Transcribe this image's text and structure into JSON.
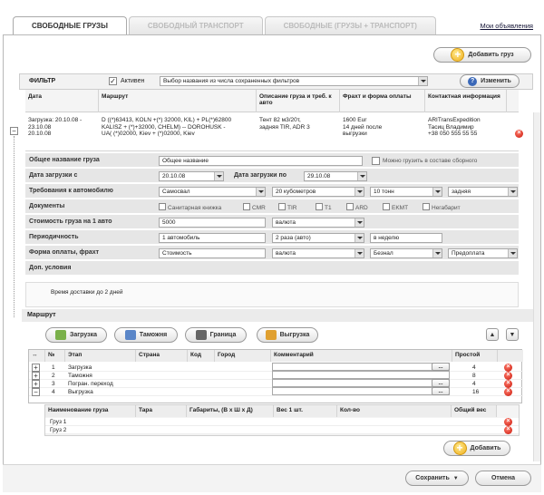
{
  "tabs": [
    {
      "label": "СВОБОДНЫЕ ГРУЗЫ"
    },
    {
      "label": "СВОБОДНЫЙ ТРАНСПОРТ"
    },
    {
      "label": "СВОБОДНЫЕ (ГРУЗЫ + ТРАНСПОРТ)"
    }
  ],
  "top_link": "Мои объявления",
  "add_cargo_label": "Добавить груз",
  "filter": {
    "label": "ФИЛЬТР",
    "active_label": "Активен",
    "active_checked": "✓",
    "saved_select": "Выбор названия из числа сохраненных фильтров",
    "change_label": "Изменить"
  },
  "columns": {
    "date": "Дата",
    "route": "Маршрут",
    "desc": "Описание груза и треб. к авто",
    "freight": "Фрахт и форма оплаты",
    "contact": "Контактная информация"
  },
  "summary": {
    "date": "Загрузка: 20.10.08 -\n        23.10.08\n20.10.08",
    "route": "D ((*)63413, KOLN  +(*) 32000, KIL) + PL(*)62800\nKALISZ + (*)+32000, CHELM) -- DOROHUSK -\nUA( (*)02000, Kiev + (*)02000, Kiev",
    "desc": "Тент 82 м3/20т,\nзадняя TIR, ADR 3",
    "freight": "1600 Eur\n14 дней после\nвыгрузки",
    "contact": "ARITransExpedition\nТасиц Владимир\n+38 050 555 55 55"
  },
  "form": {
    "cargo_name_label": "Общее название груза",
    "cargo_name_value": "Общее название",
    "consolidated_label": "Можно грузить в составе сборного",
    "load_from_label": "Дата загрузки с",
    "load_from_value": "20.10.08",
    "load_to_label": "Дата загрузки по",
    "load_to_value": "29.10.08",
    "req_label": "Требования к автомобилю",
    "req_body": "Самосвал",
    "req_volume": "20 кубометров",
    "req_weight": "10 тонн",
    "req_loading": "задняя",
    "docs_label": "Документы",
    "docs": [
      "Санитарная книжка",
      "CMR",
      "TIR",
      "T1",
      "ARD",
      "EKMT",
      "Негабарит"
    ],
    "cost_label": "Стоимость груза на 1 авто",
    "cost_value": "5000",
    "cost_currency": "валюта",
    "period_label": "Периодичность",
    "period_autos": "1 автомобиль",
    "period_times": "2 раза (авто)",
    "period_unit": "в неделю",
    "pay_label": "Форма оплаты, фрахт",
    "pay_cost": "Стоимость",
    "pay_currency": "валюта",
    "pay_type": "Безнал",
    "pay_terms": "Предоплата",
    "extra_label": "Доп. условия",
    "extra_value": "Время доставки до 2 дней"
  },
  "route": {
    "title": "Маршрут",
    "buttons": [
      "Загрузка",
      "Таможня",
      "Граница",
      "Выгрузка"
    ],
    "headers": [
      "№",
      "Этап",
      "Страна",
      "Код",
      "Город",
      "Комментарий",
      "Простой"
    ],
    "rows": [
      {
        "n": "1",
        "stage": "Загрузка",
        "idle": "4",
        "toggle": "+"
      },
      {
        "n": "2",
        "stage": "Таможня",
        "idle": "8",
        "toggle": "+"
      },
      {
        "n": "3",
        "stage": "Погран. переход",
        "idle": "4",
        "toggle": "+"
      },
      {
        "n": "4",
        "stage": "Выгрузка",
        "idle": "16",
        "toggle": "−"
      }
    ],
    "sub_headers": [
      "Наименование груза",
      "Тара",
      "Габариты, (В х Ш х Д)",
      "Вес 1 шт.",
      "Кол-во",
      "Общий вес"
    ],
    "sub_rows": [
      {
        "name": "Груз 1"
      },
      {
        "name": "Груз 2"
      }
    ],
    "dots": "...",
    "add_label": "Добавить"
  },
  "footer": {
    "save": "Сохранить",
    "cancel": "Отмена"
  }
}
